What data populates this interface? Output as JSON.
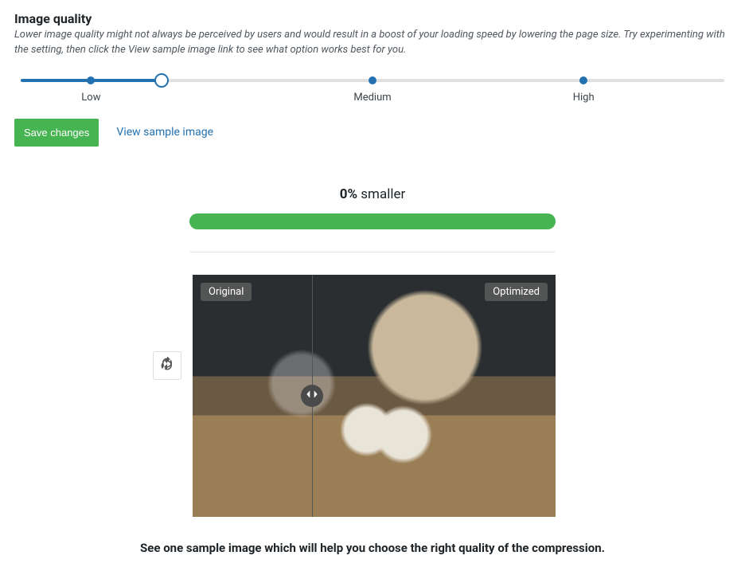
{
  "header": {
    "title": "Image quality",
    "description": "Lower image quality might not always be perceived by users and would result in a boost of your loading speed by lowering the page size. Try experimenting with the setting, then click the View sample image link to see what option works best for you."
  },
  "slider": {
    "labels": {
      "low": "Low",
      "medium": "Medium",
      "high": "High"
    },
    "value_percent": 20
  },
  "actions": {
    "save_label": "Save changes",
    "view_sample_label": "View sample image"
  },
  "result": {
    "percent_text": "0%",
    "suffix": " smaller",
    "progress_percent": 100
  },
  "compare": {
    "original_label": "Original",
    "optimized_label": "Optimized",
    "split_percent": 33
  },
  "footer": {
    "hint": "See one sample image which will help you choose the right quality of the compression."
  }
}
